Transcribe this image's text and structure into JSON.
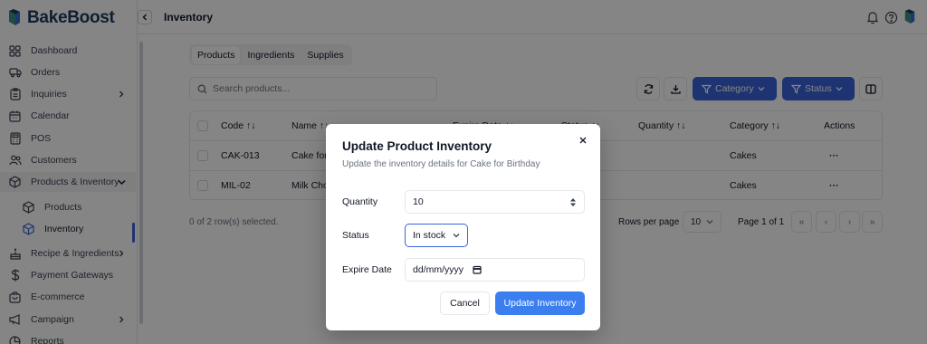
{
  "app": {
    "name": "BakeBoost"
  },
  "header": {
    "title": "Inventory"
  },
  "sidebar": {
    "items": [
      {
        "label": "Dashboard",
        "icon": "dashboard-icon"
      },
      {
        "label": "Orders",
        "icon": "truck-icon"
      },
      {
        "label": "Inquiries",
        "icon": "clipboard-icon"
      },
      {
        "label": "Calendar",
        "icon": "calendar-icon"
      },
      {
        "label": "POS",
        "icon": "calculator-icon"
      },
      {
        "label": "Customers",
        "icon": "users-icon"
      },
      {
        "label": "Products & Inventory",
        "icon": "box-icon"
      },
      {
        "label": "Products",
        "icon": "box-icon"
      },
      {
        "label": "Inventory",
        "icon": "box-icon"
      },
      {
        "label": "Recipe & Ingredients",
        "icon": "cake-icon"
      },
      {
        "label": "Payment Gateways",
        "icon": "dollar-icon"
      },
      {
        "label": "E-commerce",
        "icon": "shop-icon"
      },
      {
        "label": "Campaign",
        "icon": "megaphone-icon"
      },
      {
        "label": "Reports",
        "icon": "chart-icon"
      }
    ]
  },
  "tabs": [
    "Products",
    "Ingredients",
    "Supplies"
  ],
  "search": {
    "placeholder": "Search products..."
  },
  "filters": {
    "category": "Category",
    "status": "Status"
  },
  "table": {
    "headers": [
      "Code",
      "Name",
      "Expire Date",
      "Status",
      "Quantity",
      "Category",
      "Actions"
    ],
    "rows": [
      {
        "code": "CAK-013",
        "name": "Cake for",
        "category": "Cakes",
        "actions": "···"
      },
      {
        "code": "MIL-02",
        "name": "Milk Cho",
        "category": "Cakes",
        "actions": "···"
      }
    ]
  },
  "footer": {
    "selected": "0 of 2 row(s) selected.",
    "rows_per_page_label": "Rows per page",
    "rows_per_page": "10",
    "page_info": "Page 1 of 1"
  },
  "modal": {
    "title": "Update Product Inventory",
    "subtitle": "Update the inventory details for Cake for Birthday",
    "quantity_label": "Quantity",
    "quantity_value": "10",
    "status_label": "Status",
    "status_value": "In stock",
    "expire_label": "Expire Date",
    "expire_placeholder": "dd/mm/yyyy",
    "cancel_label": "Cancel",
    "update_label": "Update Inventory"
  },
  "colors": {
    "accent": "#3b63d8",
    "primary_button": "#3b7ef0"
  }
}
